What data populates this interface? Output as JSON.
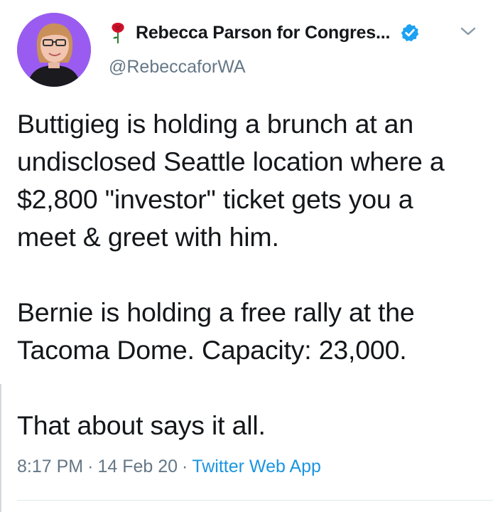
{
  "account": {
    "display_name": "Rebecca Parson for Congres...",
    "handle": "@RebeccaforWA",
    "verified": true,
    "name_emoji": "rose-icon"
  },
  "tweet": {
    "paragraphs": [
      "Buttigieg is holding a brunch at an undisclosed Seattle location where a $2,800 \"investor\" ticket gets you a meet & greet with him.",
      "Bernie is holding a free rally at the Tacoma Dome. Capacity: 23,000.",
      "That about says it all."
    ],
    "time": "8:17 PM",
    "date": "14 Feb 20",
    "source": "Twitter Web App",
    "separator": "·"
  },
  "colors": {
    "text": "#14171a",
    "secondary": "#657786",
    "link": "#1b95e0",
    "avatar_bg": "#9a5cf0",
    "verified": "#1da1f2"
  }
}
